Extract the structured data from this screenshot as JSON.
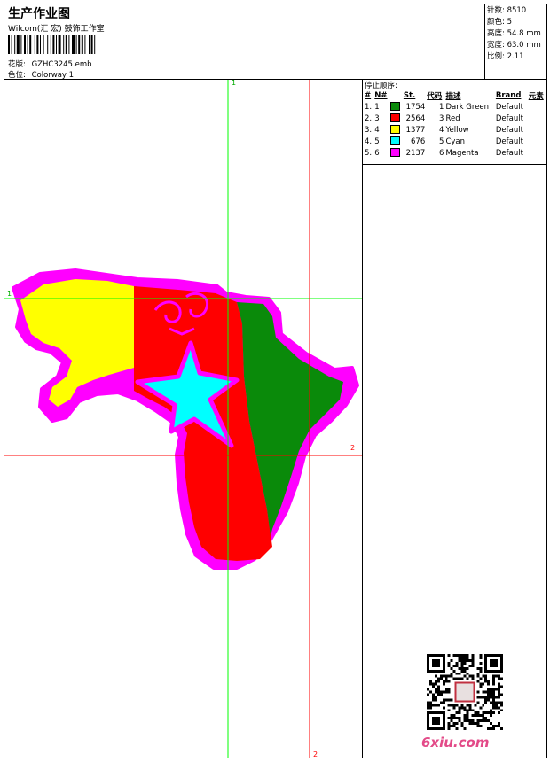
{
  "header": {
    "title": "生产作业图",
    "company": "Wilcom(汇 宏) 鼓饰工作室",
    "design_label": "花版:",
    "design_value": "GZHC3245.emb",
    "colorway_label": "色位:",
    "colorway_value": "Colorway 1"
  },
  "stats": [
    {
      "label": "针数:",
      "value": "8510"
    },
    {
      "label": "颜色:",
      "value": "5"
    },
    {
      "label": "高度:",
      "value": "54.8 mm"
    },
    {
      "label": "宽度:",
      "value": "63.0 mm"
    },
    {
      "label": "比例:",
      "value": "2.11"
    }
  ],
  "stop_sequence": {
    "title": "停止顺序:",
    "columns": [
      "#",
      "N#",
      "St.",
      "代码",
      "描述",
      "Brand",
      "元素"
    ],
    "rows": [
      {
        "idx": "1.",
        "n": "1",
        "color": "#0a8a0a",
        "st": "1754",
        "code": "1",
        "desc": "Dark Green",
        "brand": "Default",
        "elem": ""
      },
      {
        "idx": "2.",
        "n": "3",
        "color": "#ff0000",
        "st": "2564",
        "code": "3",
        "desc": "Red",
        "brand": "Default",
        "elem": ""
      },
      {
        "idx": "3.",
        "n": "4",
        "color": "#ffff00",
        "st": "1377",
        "code": "4",
        "desc": "Yellow",
        "brand": "Default",
        "elem": ""
      },
      {
        "idx": "4.",
        "n": "5",
        "color": "#00ffff",
        "st": "676",
        "code": "5",
        "desc": "Cyan",
        "brand": "Default",
        "elem": ""
      },
      {
        "idx": "5.",
        "n": "6",
        "color": "#ff00ff",
        "st": "2137",
        "code": "6",
        "desc": "Magenta",
        "brand": "Default",
        "elem": ""
      }
    ]
  },
  "guides": {
    "v1_label": "1",
    "h1_label": "1",
    "h2_label": "2",
    "v2_label": "2"
  },
  "colors": {
    "guide_green": "#00ff00",
    "guide_red": "#ff0000",
    "magenta": "#ff00ff",
    "yellow": "#ffff00",
    "red": "#ff0000",
    "green": "#0a8a0a",
    "cyan": "#00ffff"
  },
  "watermark": "6xiu.com"
}
